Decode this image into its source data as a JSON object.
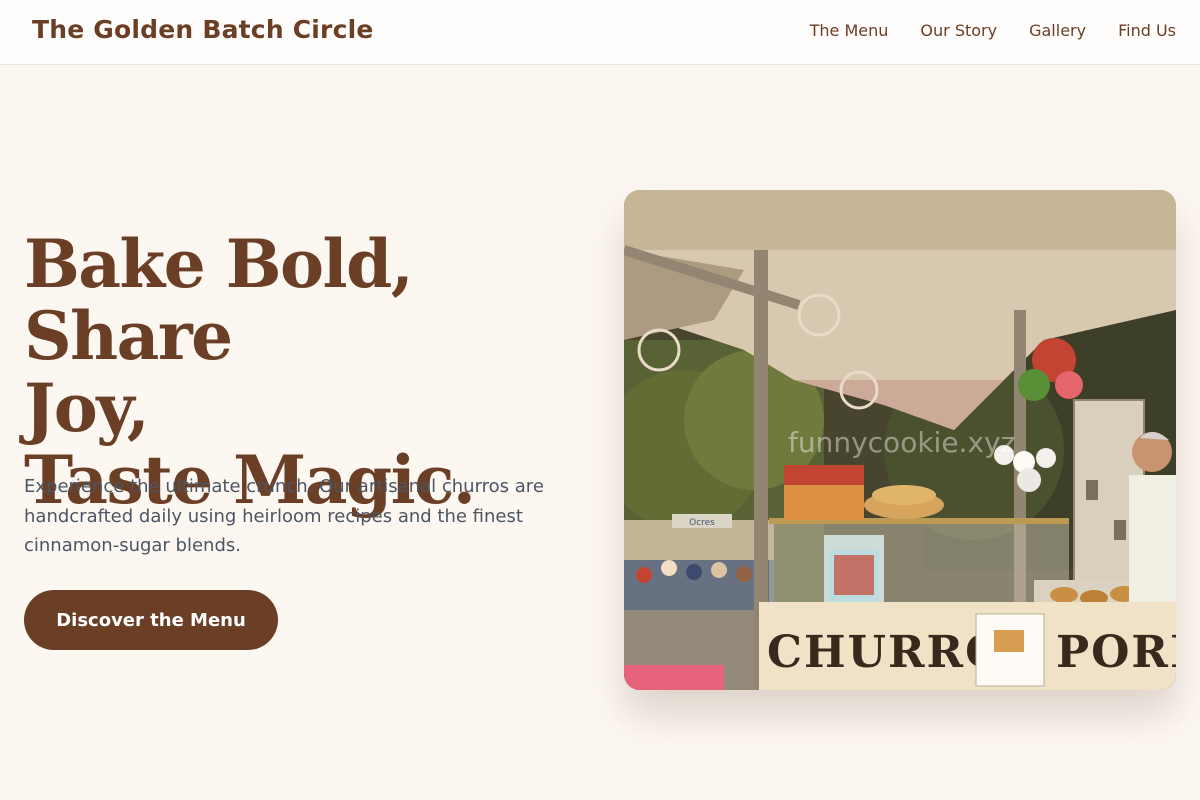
{
  "header": {
    "brand": "The Golden Batch Circle",
    "nav": [
      {
        "label": "The Menu"
      },
      {
        "label": "Our Story"
      },
      {
        "label": "Gallery"
      },
      {
        "label": "Find Us"
      }
    ]
  },
  "hero": {
    "title_lines": [
      "Bake Bold, Share",
      "Joy,",
      "Taste Magic."
    ],
    "description": "Experience the ultimate crunch. Our artisanal churros are handcrafted daily using heirloom recipes and the finest cinnamon-sugar blends.",
    "cta_label": "Discover the Menu"
  },
  "image": {
    "watermark": "funnycookie.xyz",
    "sign_text_1": "CHURROS",
    "sign_text_2": "PORRAS",
    "small_sign": "Ocres"
  },
  "colors": {
    "brand": "#6b3e26",
    "background": "#fdf7f2",
    "body_text": "#4c5563"
  }
}
